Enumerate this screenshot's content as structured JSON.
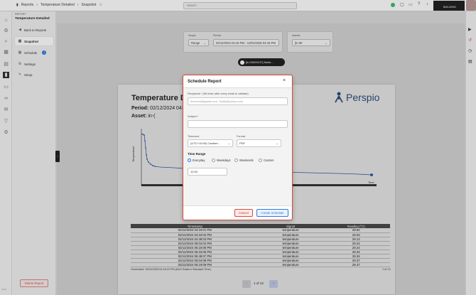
{
  "topbar": {
    "breadcrumb": [
      "Reports",
      "Temperature Detailed",
      "Snapshot"
    ],
    "search_placeholder": "Search",
    "user_name": "BUILDING"
  },
  "header": {
    "section": "REPORT",
    "title": "Temperature Detailed"
  },
  "sidebar": {
    "back_label": "Back to Reports",
    "items": [
      {
        "label": "Snapshot",
        "badge": ""
      },
      {
        "label": "Schedule",
        "badge": "1"
      },
      {
        "label": "Settings",
        "badge": ""
      },
      {
        "label": "Setup",
        "badge": ""
      }
    ],
    "delete_label": "Delete Report",
    "version": "v 2.0"
  },
  "filters": {
    "scope_label": "Scope",
    "scope_value": "Range",
    "period_label": "Period",
    "period_value": "02/12/2024 04:15 PM - 13/01/2025 04:15 PM",
    "assets_label": "Assets",
    "assets_value": "[in-00"
  },
  "asset_chip": "[in-00000137] Mohk...",
  "report": {
    "title": "Temperature D",
    "period_label": "Period:",
    "period_value": "02/12/2024 04:15",
    "asset_label": "Asset:",
    "asset_value": "in-(",
    "brand": "Perspio",
    "y_axis_label": "Temperature",
    "x_axis_label": "Time",
    "legend": "Temperature",
    "footer_left": "Generated: 13/01/2025 04:16:15 PM (AUS Eastern Standard Time)",
    "footer_right": "1 of 13"
  },
  "table": {
    "headers": [
      "Timestamp",
      "Signal",
      "Reading (°C)"
    ],
    "rows": [
      [
        "02/12/2024 04:19:01 PM",
        "temperature",
        "28.92"
      ],
      [
        "02/12/2024 04:34:02 PM",
        "temperature",
        "29.03"
      ],
      [
        "02/12/2024 04:49:03 PM",
        "temperature",
        "29.13"
      ],
      [
        "02/12/2024 05:04:04 PM",
        "temperature",
        "29.24"
      ],
      [
        "02/12/2024 05:19:05 PM",
        "temperature",
        "29.24"
      ],
      [
        "02/12/2024 05:34:06 PM",
        "temperature",
        "29.34"
      ],
      [
        "02/12/2024 05:49:07 PM",
        "temperature",
        "29.34"
      ],
      [
        "02/12/2024 06:04:08 PM",
        "temperature",
        "29.37"
      ],
      [
        "02/12/2024 06:19:09 PM",
        "temperature",
        "29.37"
      ]
    ]
  },
  "pagination": {
    "text": "1 of 13"
  },
  "modal": {
    "title": "Schedule Report",
    "recipients_label": "Recipients * (Hit enter after every email to validate)",
    "recipients_placeholder": "trent.test@gmail.com, Smith@yahoo.com",
    "subject_label": "Subject *",
    "subject_value": "",
    "timezone_label": "Timezone",
    "timezone_value": "(UTC+10:00) Canberr...",
    "format_label": "Format",
    "format_value": "PDF",
    "time_range_label": "Time Range",
    "options": [
      "Everyday",
      "Weekdays",
      "Weekends",
      "Custom"
    ],
    "selected_option": "Everyday",
    "time_value": "12:00",
    "cancel_label": "Cancel",
    "create_label": "Create Schedule"
  },
  "colors": {
    "accent": "#2c7be5",
    "danger": "#d84a3a",
    "series": "#3557a8"
  }
}
